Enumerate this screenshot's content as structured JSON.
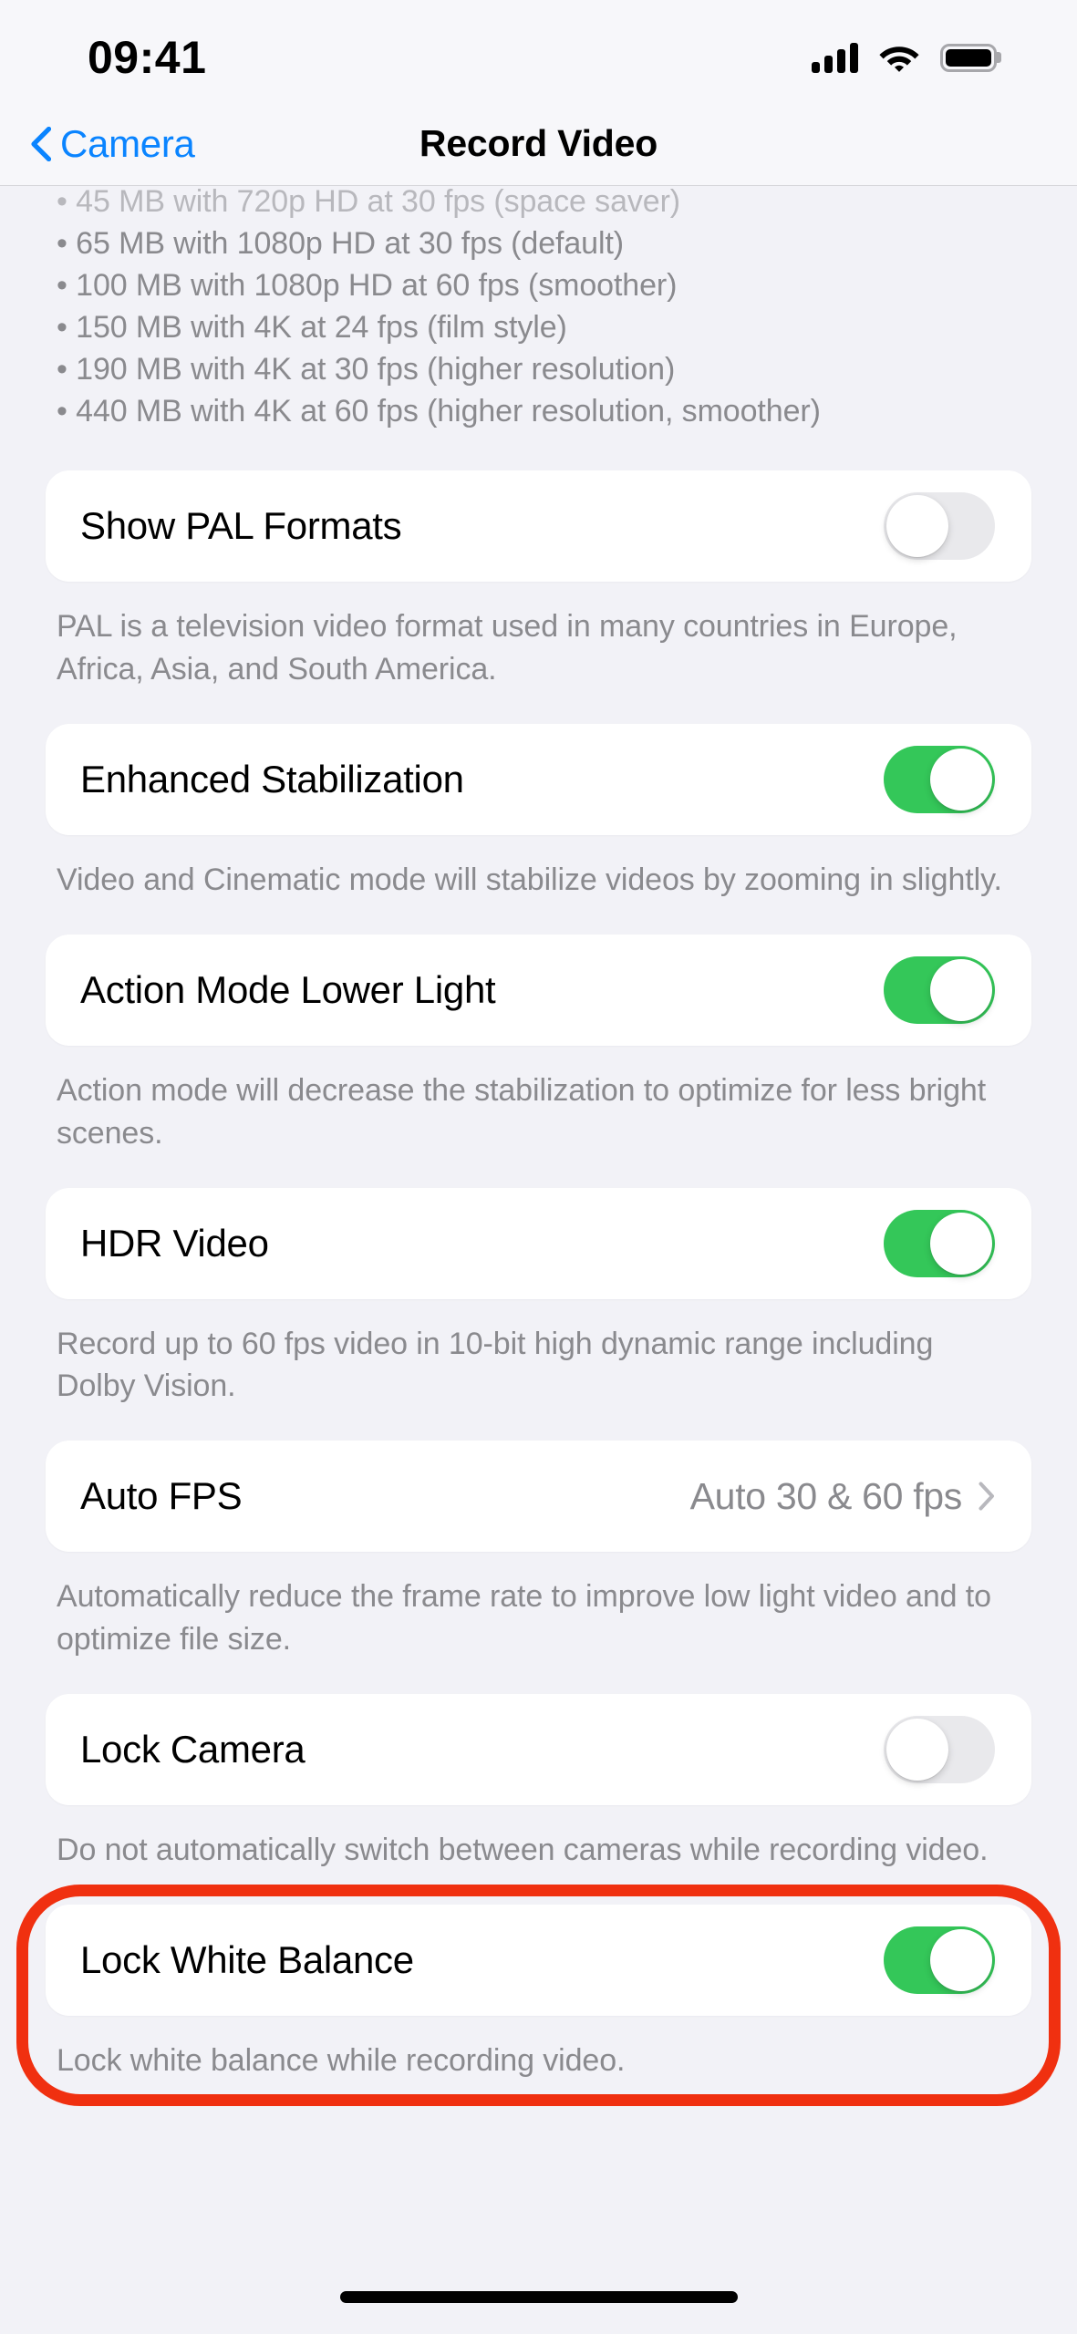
{
  "status_bar": {
    "time": "09:41",
    "icons": [
      "cellular-signal-icon",
      "wifi-icon",
      "battery-icon"
    ]
  },
  "nav_bar": {
    "back_label": "Camera",
    "back_icon": "chevron-left-icon",
    "title": "Record Video"
  },
  "top_footnote": {
    "bullets": [
      "• 45 MB with 720p HD at 30 fps (space saver)",
      "• 65 MB with 1080p HD at 30 fps (default)",
      "• 100 MB with 1080p HD at 60 fps (smoother)",
      "• 150 MB with 4K at 24 fps (film style)",
      "• 190 MB with 4K at 30 fps (higher resolution)",
      "• 440 MB with 4K at 60 fps (higher resolution, smoother)"
    ]
  },
  "sections": [
    {
      "id": "show-pal-formats",
      "label": "Show PAL Formats",
      "control": "toggle",
      "state": "off",
      "footer": "PAL is a television video format used in many countries in Europe, Africa, Asia, and South America."
    },
    {
      "id": "enhanced-stabilization",
      "label": "Enhanced Stabilization",
      "control": "toggle",
      "state": "on",
      "footer": "Video and Cinematic mode will stabilize videos by zooming in slightly."
    },
    {
      "id": "action-mode-lower-light",
      "label": "Action Mode Lower Light",
      "control": "toggle",
      "state": "on",
      "footer": "Action mode will decrease the stabilization to optimize for less bright scenes."
    },
    {
      "id": "hdr-video",
      "label": "HDR Video",
      "control": "toggle",
      "state": "on",
      "footer": "Record up to 60 fps video in 10-bit high dynamic range including Dolby Vision."
    },
    {
      "id": "auto-fps",
      "label": "Auto FPS",
      "control": "disclosure",
      "value": "Auto 30 & 60 fps",
      "chevron_icon": "chevron-right-icon",
      "footer": "Automatically reduce the frame rate to improve low light video and to optimize file size."
    },
    {
      "id": "lock-camera",
      "label": "Lock Camera",
      "control": "toggle",
      "state": "off",
      "footer": "Do not automatically switch between cameras while recording video."
    },
    {
      "id": "lock-white-balance",
      "label": "Lock White Balance",
      "control": "toggle",
      "state": "on",
      "footer": "Lock white balance while recording video.",
      "highlighted": true
    }
  ],
  "colors": {
    "toggle_on": "#34c759",
    "toggle_off": "#e9e9ec",
    "accent_blue": "#0a84ff",
    "annotation_red": "#f03010",
    "page_background": "#f2f2f7",
    "card_background": "#ffffff",
    "secondary_text": "#8a8a8e"
  },
  "home_indicator": "home-indicator"
}
